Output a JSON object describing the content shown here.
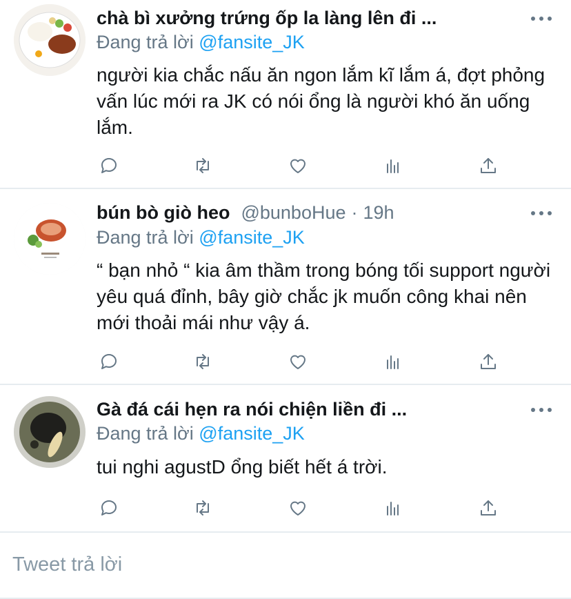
{
  "tweets": [
    {
      "name": "chà bì xưởng trứng ốp la làng lên đi ...",
      "handle": "",
      "time": "",
      "replying_label": "Đang trả lời",
      "replying_to": "@fansite_JK",
      "text": "người kia chắc nấu ăn ngon lắm kĩ lắm á, đợt phỏng vấn lúc mới ra JK có nói ổng là người khó ăn uống lắm.",
      "avatar": "food-plate-avatar"
    },
    {
      "name": "bún bò giò heo",
      "handle": "@bunboHue",
      "sep": "·",
      "time": "19h",
      "replying_label": "Đang trả lời",
      "replying_to": "@fansite_JK",
      "text": "“ bạn nhỏ “ kia âm thầm trong bóng tối support người yêu quá đỉnh, bây giờ chắc jk muốn công khai nên mới thoải mái như vậy á.",
      "avatar": "noodle-bowl-avatar"
    },
    {
      "name": "Gà đá cái hẹn ra nói chiện liền đi ...",
      "handle": "",
      "time": "",
      "replying_label": "Đang trả lời",
      "replying_to": "@fansite_JK",
      "text": "tui nghi agustD ổng biết hết á trời.",
      "avatar": "chicken-soup-avatar"
    }
  ],
  "actions": [
    "reply-icon",
    "retweet-icon",
    "like-icon",
    "analytics-icon",
    "share-icon"
  ],
  "compose": {
    "placeholder": "Tweet trả lời"
  },
  "colors": {
    "accent": "#1da1f2",
    "secondary_text": "#657786",
    "divider": "#e6ecf0"
  }
}
